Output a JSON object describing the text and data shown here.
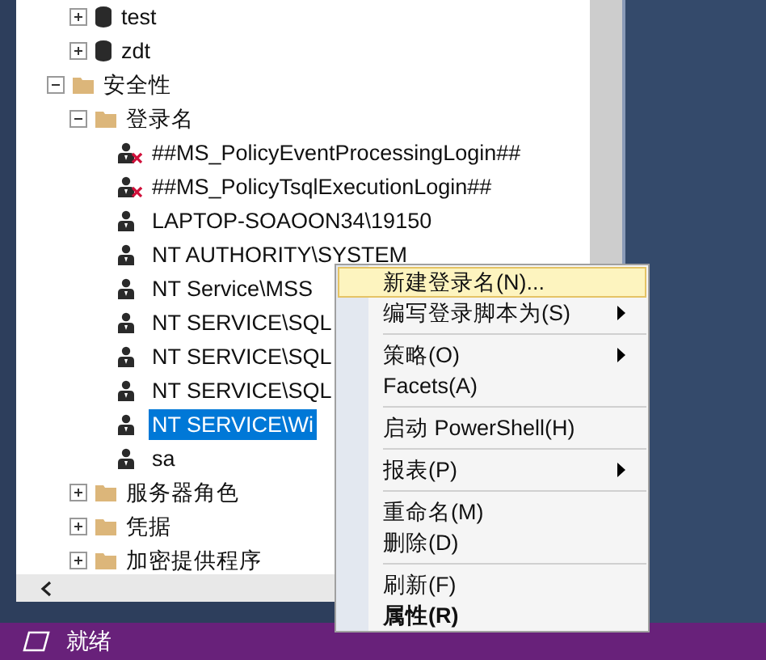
{
  "tree_partial": [
    {
      "label": "test",
      "kind": "database",
      "expanded": false
    },
    {
      "label": "zdt",
      "kind": "database",
      "expanded": false
    }
  ],
  "tree": [
    {
      "label": "安全性",
      "kind": "folder",
      "expanded": true,
      "children": [
        {
          "label": "登录名",
          "kind": "folder",
          "expanded": true,
          "children": [
            {
              "label": "##MS_PolicyEventProcessingLogin##",
              "kind": "login",
              "disabled": true,
              "selected": false
            },
            {
              "label": "##MS_PolicyTsqlExecutionLogin##",
              "kind": "login",
              "disabled": true,
              "selected": false
            },
            {
              "label": "LAPTOP-SOAOON34\\19150",
              "kind": "login",
              "disabled": false,
              "selected": false
            },
            {
              "label": "NT AUTHORITY\\SYSTEM",
              "kind": "login",
              "disabled": false,
              "selected": false
            },
            {
              "label": "NT Service\\MSS",
              "kind": "login",
              "disabled": false,
              "selected": false
            },
            {
              "label": "NT SERVICE\\SQL",
              "kind": "login",
              "disabled": false,
              "selected": false
            },
            {
              "label": "NT SERVICE\\SQL",
              "kind": "login",
              "disabled": false,
              "selected": false
            },
            {
              "label": "NT SERVICE\\SQL",
              "kind": "login",
              "disabled": false,
              "selected": false
            },
            {
              "label": "NT SERVICE\\Wi",
              "kind": "login",
              "disabled": false,
              "selected": true
            },
            {
              "label": "sa",
              "kind": "login",
              "disabled": false,
              "selected": false
            }
          ]
        },
        {
          "label": "服务器角色",
          "kind": "folder",
          "expanded": false
        },
        {
          "label": "凭据",
          "kind": "folder",
          "expanded": false
        },
        {
          "label": "加密提供程序",
          "kind": "folder",
          "expanded": false
        }
      ]
    }
  ],
  "context_menu": [
    {
      "kind": "item",
      "label": "新建登录名(N)...",
      "selected": true,
      "submenu": false,
      "bold": false
    },
    {
      "kind": "item",
      "label": "编写登录脚本为(S)",
      "selected": false,
      "submenu": true,
      "bold": false
    },
    {
      "kind": "separator"
    },
    {
      "kind": "item",
      "label": "策略(O)",
      "selected": false,
      "submenu": true,
      "bold": false
    },
    {
      "kind": "item",
      "label": "Facets(A)",
      "selected": false,
      "submenu": false,
      "bold": false
    },
    {
      "kind": "separator"
    },
    {
      "kind": "item",
      "label": "启动 PowerShell(H)",
      "selected": false,
      "submenu": false,
      "bold": false
    },
    {
      "kind": "separator"
    },
    {
      "kind": "item",
      "label": "报表(P)",
      "selected": false,
      "submenu": true,
      "bold": false
    },
    {
      "kind": "separator"
    },
    {
      "kind": "item",
      "label": "重命名(M)",
      "selected": false,
      "submenu": false,
      "bold": false
    },
    {
      "kind": "item",
      "label": "删除(D)",
      "selected": false,
      "submenu": false,
      "bold": false
    },
    {
      "kind": "separator"
    },
    {
      "kind": "item",
      "label": "刷新(F)",
      "selected": false,
      "submenu": false,
      "bold": false
    },
    {
      "kind": "item",
      "label": "属性(R)",
      "selected": false,
      "submenu": false,
      "bold": true
    }
  ],
  "status_bar": {
    "text": "就绪"
  }
}
